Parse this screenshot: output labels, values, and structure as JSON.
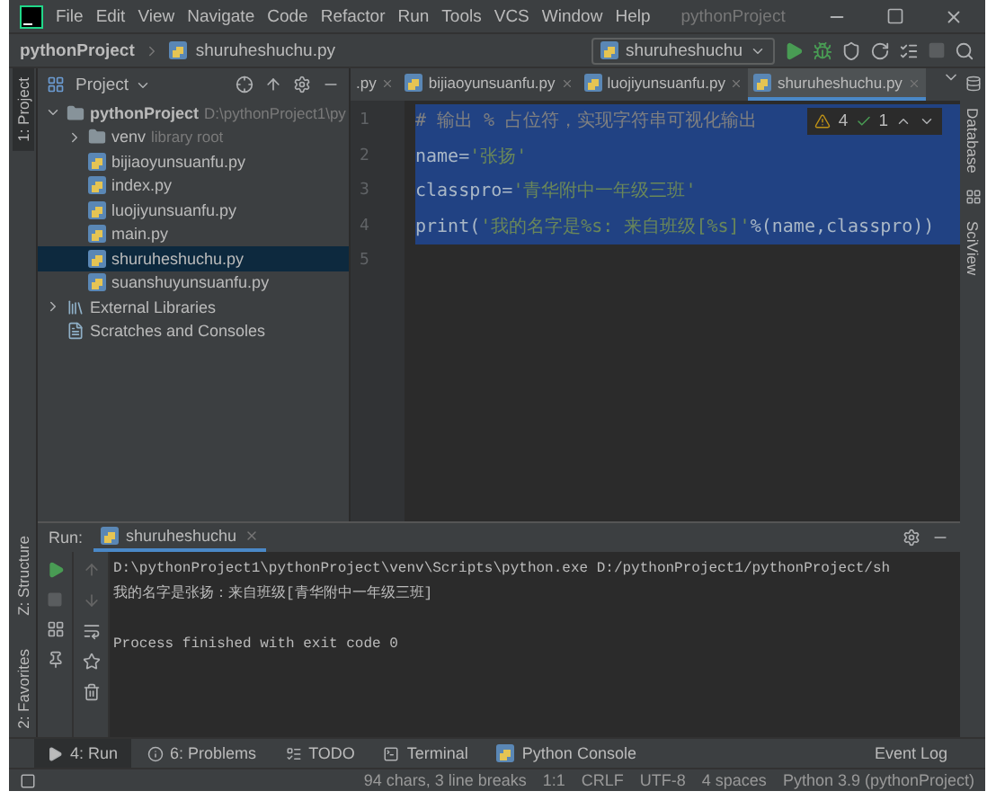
{
  "menu": [
    "File",
    "Edit",
    "View",
    "Navigate",
    "Code",
    "Refactor",
    "Run",
    "Tools",
    "VCS",
    "Window",
    "Help"
  ],
  "window": {
    "title": "pythonProject"
  },
  "navbar": {
    "breadcrumb": [
      "pythonProject",
      "shuruheshuchu.py"
    ],
    "run_config": "shuruheshuchu"
  },
  "left_stripe": [
    {
      "label": "1: Project",
      "selected": true,
      "kind": "top"
    },
    {
      "label": "Z: Structure",
      "selected": false,
      "kind": "bottom"
    },
    {
      "label": "2: Favorites",
      "selected": false,
      "kind": "bottom"
    }
  ],
  "project_panel": {
    "title": "Project",
    "tree": [
      {
        "name": "pythonProject",
        "hint": "D:\\pythonProject1\\py",
        "kind": "folder",
        "expanded": true,
        "selected": false,
        "children": [
          {
            "name": "venv",
            "hint": "library root",
            "kind": "folder",
            "expanded": false,
            "selected": false
          },
          {
            "name": "bijiaoyunsuanfu.py",
            "kind": "python",
            "selected": false
          },
          {
            "name": "index.py",
            "kind": "python",
            "selected": false
          },
          {
            "name": "luojiyunsuanfu.py",
            "kind": "python",
            "selected": false
          },
          {
            "name": "main.py",
            "kind": "python",
            "selected": false
          },
          {
            "name": "shuruheshuchu.py",
            "kind": "python",
            "selected": true
          },
          {
            "name": "suanshuyunsuanfu.py",
            "kind": "python",
            "selected": false
          }
        ]
      },
      {
        "name": "External Libraries",
        "kind": "libraries",
        "expanded": false,
        "selected": false
      },
      {
        "name": "Scratches and Consoles",
        "kind": "scratches",
        "selected": false
      }
    ]
  },
  "editor": {
    "tabs": [
      {
        "label": ".py",
        "selected": false
      },
      {
        "label": "bijiaoyunsuanfu.py",
        "selected": false
      },
      {
        "label": "luojiyunsuanfu.py",
        "selected": false
      },
      {
        "label": "shuruheshuchu.py",
        "selected": true
      }
    ],
    "inspections": {
      "warnings": "4",
      "ok": "1"
    },
    "lines": [
      {
        "number": "1",
        "selected": true,
        "tokens": [
          {
            "text": "# 输出 % 占位符，实现字符串可视化输出",
            "kind": "comment"
          }
        ]
      },
      {
        "number": "2",
        "selected": true,
        "tokens": [
          {
            "text": "name=",
            "kind": "plain"
          },
          {
            "text": "'张扬'",
            "kind": "string"
          }
        ]
      },
      {
        "number": "3",
        "selected": true,
        "tokens": [
          {
            "text": "classpro=",
            "kind": "plain"
          },
          {
            "text": "'青华附中一年级三班'",
            "kind": "string"
          }
        ]
      },
      {
        "number": "4",
        "selected": true,
        "tokens": [
          {
            "text": "print(",
            "kind": "plain"
          },
          {
            "text": "'我的名字是%s: 来自班级[%s]'",
            "kind": "string"
          },
          {
            "text": "%(name,classpro))",
            "kind": "plain"
          }
        ]
      },
      {
        "number": "5",
        "selected": false
      }
    ]
  },
  "right_stripe": [
    "Database",
    "SciView"
  ],
  "run_panel": {
    "label": "Run:",
    "tab": "shuruheshuchu",
    "output": [
      {
        "text": "D:\\pythonProject1\\pythonProject\\venv\\Scripts\\python.exe D:/pythonProject1/pythonProject/sh",
        "kind": "command"
      },
      {
        "text": "我的名字是张扬：来自班级[青华附中一年级三班]",
        "kind": "output"
      },
      {
        "text": "Process finished with exit code 0",
        "kind": "exit"
      }
    ]
  },
  "bottom_tabs": [
    {
      "label": "4: Run",
      "selected": true,
      "kind": "run"
    },
    {
      "label": "6: Problems",
      "selected": false,
      "kind": "problems"
    },
    {
      "label": "TODO",
      "selected": false,
      "kind": "todo"
    },
    {
      "label": "Terminal",
      "selected": false,
      "kind": "terminal"
    },
    {
      "label": "Python Console",
      "selected": false,
      "kind": "console"
    }
  ],
  "event_log": "Event Log",
  "status_bar": [
    "94 chars, 3 line breaks",
    "1:1",
    "CRLF",
    "UTF-8",
    "4 spaces",
    "Python 3.9 (pythonProject)"
  ]
}
